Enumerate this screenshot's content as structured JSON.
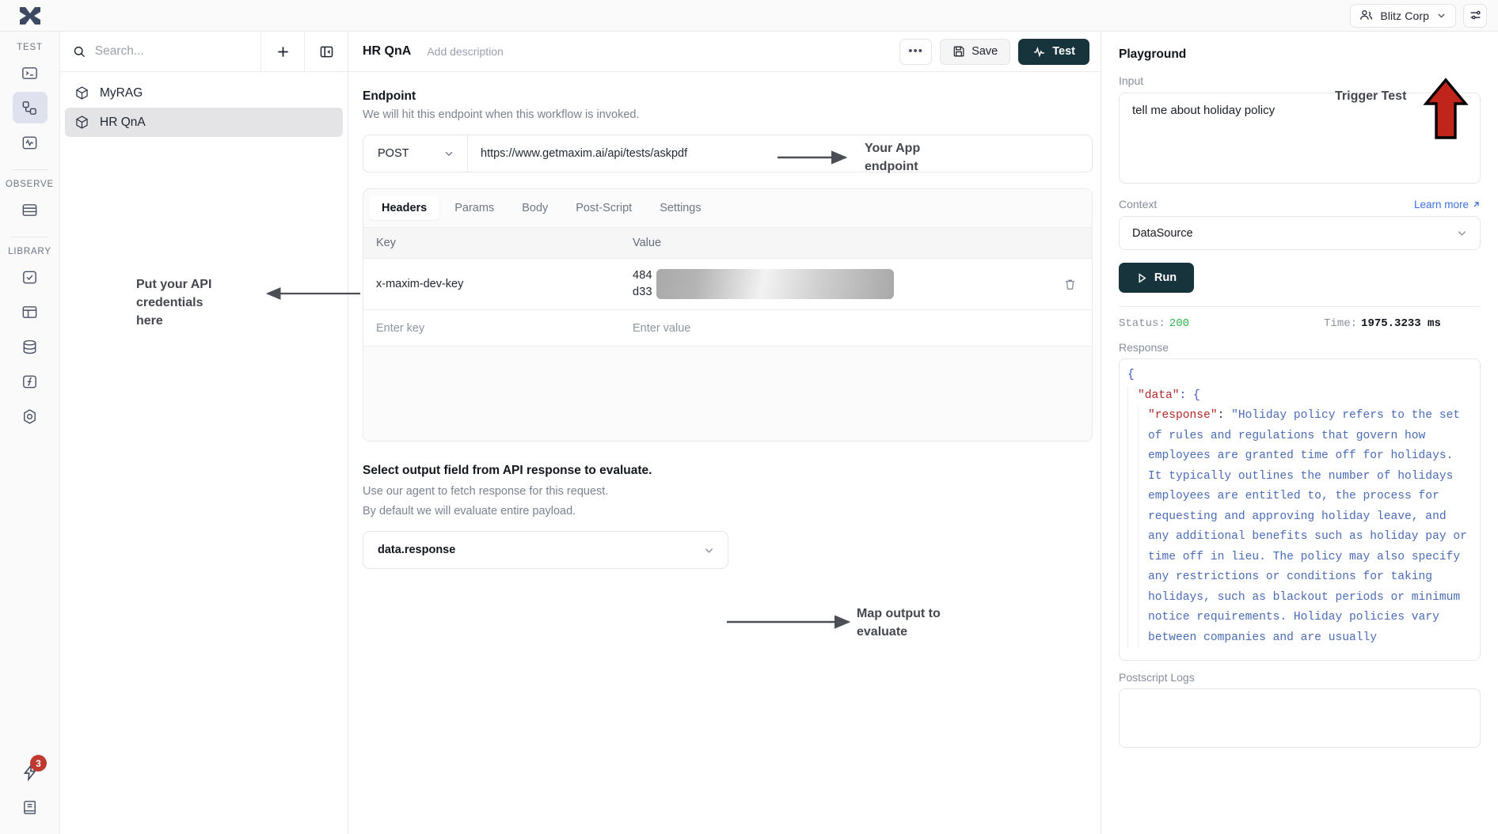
{
  "topbar": {
    "org_name": "Blitz Corp",
    "org_icon": "users-icon",
    "chevron_icon": "chevron-down-icon",
    "settings_icon": "sliders-icon",
    "logo_icon": "maxim-logo-icon"
  },
  "rail": {
    "sections": [
      {
        "label": "TEST",
        "items": [
          {
            "name": "prompt-icon",
            "active": false
          },
          {
            "name": "workflow-icon",
            "active": true
          },
          {
            "name": "activity-icon",
            "active": false
          }
        ]
      },
      {
        "label": "OBSERVE",
        "items": [
          {
            "name": "logs-icon",
            "active": false
          }
        ]
      },
      {
        "label": "LIBRARY",
        "items": [
          {
            "name": "checklist-icon",
            "active": false
          },
          {
            "name": "dataset-icon",
            "active": false
          },
          {
            "name": "database-icon",
            "active": false
          },
          {
            "name": "function-icon",
            "active": false
          },
          {
            "name": "evaluator-icon",
            "active": false
          }
        ]
      }
    ],
    "bottom": [
      {
        "name": "bolt-icon",
        "badge": "3"
      },
      {
        "name": "docs-icon",
        "badge": ""
      }
    ]
  },
  "list_panel": {
    "search_placeholder": "Search...",
    "add_icon": "plus-icon",
    "collapse_icon": "panel-collapse-icon",
    "search_icon": "search-icon",
    "items": [
      {
        "label": "MyRAG",
        "icon": "package-icon",
        "selected": false
      },
      {
        "label": "HR QnA",
        "icon": "package-icon",
        "selected": true
      }
    ]
  },
  "workflow_header": {
    "title": "HR QnA",
    "description_placeholder": "Add description",
    "more_label": "•••",
    "save_label": "Save",
    "save_icon": "floppy-disk-icon",
    "test_label": "Test",
    "test_icon": "activity-pulse-icon"
  },
  "endpoint": {
    "title": "Endpoint",
    "subtitle": "We will hit this endpoint when this workflow is invoked.",
    "method": "POST",
    "method_chevron": "chevron-down-icon",
    "url": "https://www.getmaxim.ai/api/tests/askpdf"
  },
  "request_tabs": {
    "tabs": [
      "Headers",
      "Params",
      "Body",
      "Post-Script",
      "Settings"
    ],
    "active": "Headers",
    "columns": [
      "Key",
      "Value"
    ],
    "rows": [
      {
        "key": "x-maxim-dev-key",
        "value_line1": "484",
        "value_line2": "d33",
        "redacted": true,
        "delete_icon": "trash-icon"
      }
    ],
    "empty_row": {
      "key_placeholder": "Enter key",
      "value_placeholder": "Enter value"
    }
  },
  "output_field": {
    "title": "Select output field from API response to evaluate.",
    "sub1": "Use our agent to fetch response for this request.",
    "sub2": "By default we will evaluate entire payload.",
    "selected": "data.response",
    "chevron": "chevron-down-icon"
  },
  "playground": {
    "title": "Playground",
    "input_label": "Input",
    "input_value": "tell me about holiday policy",
    "context_label": "Context",
    "learn_more": "Learn more",
    "learn_more_icon": "external-link-icon",
    "context_value": "DataSource",
    "context_chevron": "chevron-down-icon",
    "run_label": "Run",
    "run_icon": "play-icon",
    "status_label": "Status:",
    "status_value": "200",
    "status_color": "#2fb34b",
    "time_label": "Time:",
    "time_value": "1975.3233 ms",
    "response_label": "Response",
    "postscript_label": "Postscript Logs",
    "postscript_value": "",
    "response_json": {
      "open_brace": "{",
      "data_key": "\"data\"",
      "data_colon_brace": ": {",
      "response_key": "\"response\"",
      "response_colon": ": ",
      "response_value": "\"Holiday policy refers to the set of rules and regulations that govern how employees are granted time off for holidays. It typically outlines the number of holidays employees are entitled to, the process for requesting and approving holiday leave, and any additional benefits such as holiday pay or time off in lieu. The policy may also specify any restrictions or conditions for taking holidays, such as blackout periods or minimum notice requirements. Holiday policies vary between companies and are usually"
    }
  },
  "annotations": {
    "app_endpoint": "Your App\nendpoint",
    "api_credentials": "Put your API\ncredentials\nhere",
    "map_output": "Map output to\nevaluate",
    "trigger_test": "Trigger Test",
    "red_arrow_color": "#c0251b"
  }
}
